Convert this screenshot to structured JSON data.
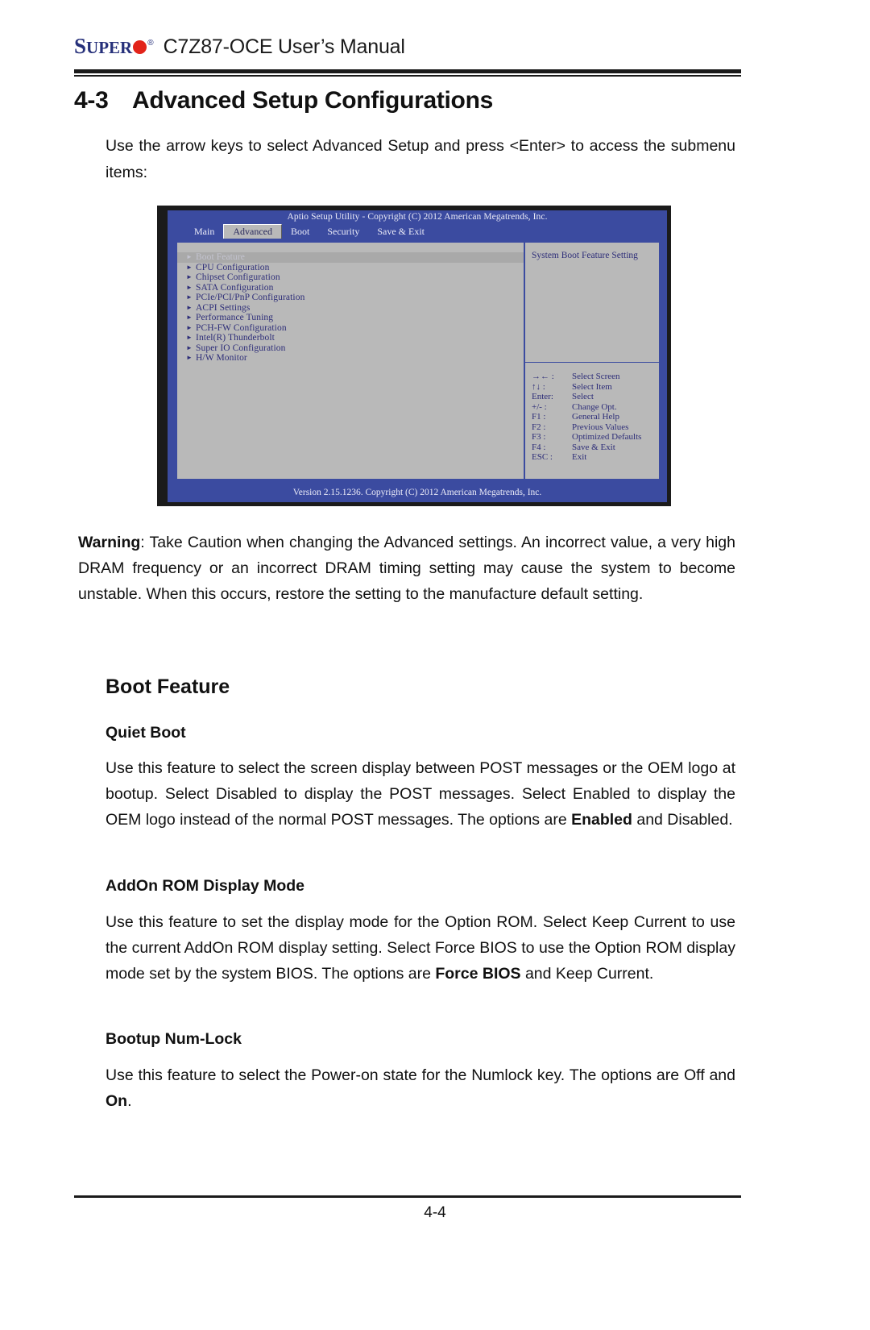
{
  "header": {
    "brand_super_cap": "S",
    "brand_super_rest": "UPER",
    "brand_registered": "®",
    "doc_title": "C7Z87-OCE User’s Manual"
  },
  "section": {
    "number": "4-3",
    "title": "Advanced Setup Configurations",
    "intro": "Use the arrow keys to select Advanced Setup and press <Enter> to access the submenu items:"
  },
  "warning": {
    "label": "Warning",
    "text": ": Take Caution when changing the Advanced settings. An incorrect value, a very high DRAM frequency or an incorrect DRAM timing setting may cause the system to become unstable. When this occurs, restore the setting to the manufacture default setting."
  },
  "feature": {
    "heading": "Boot Feature",
    "items": [
      {
        "title": "Quiet Boot",
        "body_part1": "Use this feature to select the screen display between POST messages or the OEM logo at bootup. Select Disabled to display the POST messages. Select Enabled to display the OEM logo instead of the normal POST messages. The options are ",
        "bold_value": "Enabled",
        "body_part2": " and Disabled."
      },
      {
        "title": "AddOn ROM Display Mode",
        "body_part1": "Use this feature to set the display mode for the Option ROM. Select Keep Current to use the current AddOn ROM display setting. Select Force BIOS to use the Option ROM display mode set by the system BIOS. The options are ",
        "bold_value": "Force BIOS",
        "body_part2": " and Keep Current."
      },
      {
        "title": "Bootup Num-Lock",
        "body_part1": "Use this feature to select the Power-on state for the Numlock key. The options are Off and ",
        "bold_value": "On",
        "body_part2": "."
      }
    ]
  },
  "bios": {
    "title_bar": "Aptio Setup Utility - Copyright (C) 2012 American Megatrends, Inc.",
    "tabs": [
      {
        "label": "Main",
        "active": false
      },
      {
        "label": "Advanced",
        "active": true
      },
      {
        "label": "Boot",
        "active": false
      },
      {
        "label": "Security",
        "active": false
      },
      {
        "label": "Save & Exit",
        "active": false
      }
    ],
    "menu_items": [
      {
        "label": "Boot Feature",
        "selected": true
      },
      {
        "label": "CPU Configuration",
        "selected": false
      },
      {
        "label": "Chipset Configuration",
        "selected": false
      },
      {
        "label": "SATA Configuration",
        "selected": false
      },
      {
        "label": "PCIe/PCI/PnP Configuration",
        "selected": false
      },
      {
        "label": "ACPI Settings",
        "selected": false
      },
      {
        "label": "Performance Tuning",
        "selected": false
      },
      {
        "label": "PCH-FW Configuration",
        "selected": false
      },
      {
        "label": "Intel(R) Thunderbolt",
        "selected": false
      },
      {
        "label": "Super IO Configuration",
        "selected": false
      },
      {
        "label": "H/W Monitor",
        "selected": false
      }
    ],
    "help_title": "System Boot Feature Setting",
    "help_keys": [
      {
        "key": "→← :",
        "action": "Select Screen"
      },
      {
        "key": "↑↓   :",
        "action": "Select Item"
      },
      {
        "key": "Enter:",
        "action": "Select"
      },
      {
        "key": "+/- :",
        "action": "Change Opt."
      },
      {
        "key": "F1 :",
        "action": "General Help"
      },
      {
        "key": "F2 :",
        "action": "Previous Values"
      },
      {
        "key": "F3 :",
        "action": "Optimized Defaults"
      },
      {
        "key": "F4 :",
        "action": "Save & Exit"
      },
      {
        "key": "ESC :",
        "action": "Exit"
      }
    ],
    "footer": "Version 2.15.1236. Copyright (C) 2012 American Megatrends, Inc."
  },
  "page_footer": {
    "page_number": "4-4"
  },
  "colors": {
    "bios_blue": "#3b4ba0",
    "bios_gray": "#b9b9b9",
    "bios_text_blue": "#2d2d78",
    "brand_blue": "#26307a",
    "brand_red": "#e2231a"
  }
}
